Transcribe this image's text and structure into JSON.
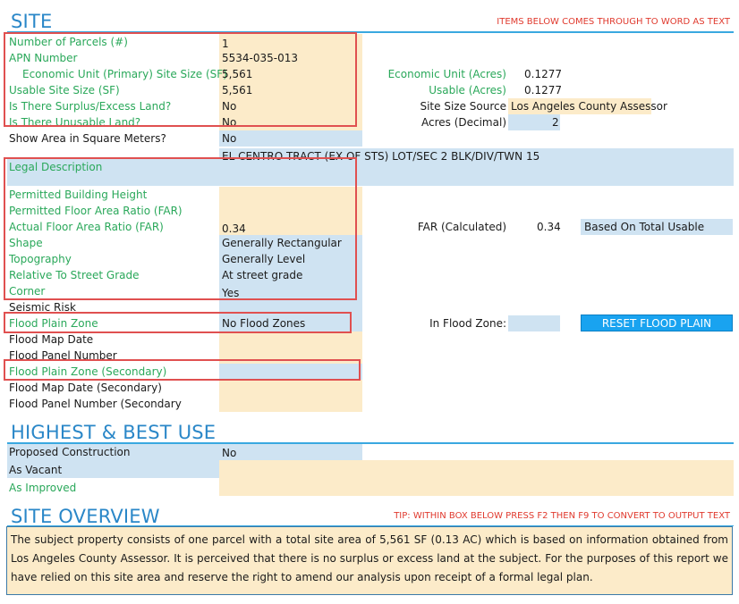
{
  "site": {
    "title": "SITE",
    "note": "ITEMS BELOW COMES THROUGH TO WORD AS TEXT",
    "rows": [
      {
        "label": "Number of Parcels (#)",
        "value": "1"
      },
      {
        "label": "APN Number",
        "value": "5534-035-013"
      },
      {
        "label": "Economic Unit (Primary) Site Size (SF)",
        "value": "5,561"
      },
      {
        "label": "Usable Site Size (SF)",
        "value": "5,561"
      },
      {
        "label": "Is There Surplus/Excess Land?",
        "value": "No"
      },
      {
        "label": "Is There Unusable Land?",
        "value": "No"
      },
      {
        "label": "Show Area in Square Meters?",
        "value": "No"
      },
      {
        "label": "Legal Description",
        "value": "EL CENTRO TRACT (EX OF STS) LOT/SEC 2 BLK/DIV/TWN 15"
      },
      {
        "label": "Permitted Building Height",
        "value": ""
      },
      {
        "label": "Permitted Floor Area Ratio (FAR)",
        "value": ""
      },
      {
        "label": "Actual Floor Area Ratio (FAR)",
        "value": "0.34"
      },
      {
        "label": "Shape",
        "value": "Generally Rectangular"
      },
      {
        "label": "Topography",
        "value": "Generally Level"
      },
      {
        "label": "Relative To Street Grade",
        "value": "At street grade"
      },
      {
        "label": "Corner",
        "value": "Yes"
      },
      {
        "label": "Seismic Risk",
        "value": ""
      },
      {
        "label": "Flood Plain Zone",
        "value": "No Flood Zones"
      },
      {
        "label": "Flood Map Date",
        "value": ""
      },
      {
        "label": "Flood Panel Number",
        "value": ""
      },
      {
        "label": "Flood Plain Zone (Secondary)",
        "value": ""
      },
      {
        "label": "Flood Map Date (Secondary)",
        "value": ""
      },
      {
        "label": "Flood Panel Number (Secondary",
        "value": ""
      }
    ],
    "right": {
      "econ_unit_acres_label": "Economic Unit (Acres)",
      "econ_unit_acres_value": "0.1277",
      "usable_acres_label": "Usable (Acres)",
      "usable_acres_value": "0.1277",
      "site_size_source_label": "Site Size Source",
      "site_size_source_value": "Los Angeles County Assessor",
      "acres_decimal_label": "Acres (Decimal)",
      "acres_decimal_value": "2",
      "far_calc_label": "FAR (Calculated)",
      "far_calc_value": "0.34",
      "far_basis_value": "Based On Total Usable",
      "in_flood_zone_label": "In Flood Zone:",
      "in_flood_zone_value": "",
      "reset_button": "RESET FLOOD PLAIN"
    }
  },
  "hbu": {
    "title": "HIGHEST & BEST USE",
    "rows": [
      {
        "label": "Proposed Construction",
        "value": "No"
      },
      {
        "label": "As Vacant",
        "value": ""
      },
      {
        "label": "As Improved",
        "value": ""
      }
    ]
  },
  "overview": {
    "title": "SITE OVERVIEW",
    "tip": "TIP: WITHIN BOX BELOW PRESS F2 THEN F9 TO CONVERT TO OUTPUT TEXT",
    "text": "The subject property consists of one parcel with a total site area of 5,561 SF (0.13 AC) which is based on information obtained from Los Angeles County Assessor. It is perceived that there is no surplus or excess land at the subject. For the purposes of this report we have relied on this site area and reserve the right to amend our analysis upon receipt of a formal legal plan."
  }
}
